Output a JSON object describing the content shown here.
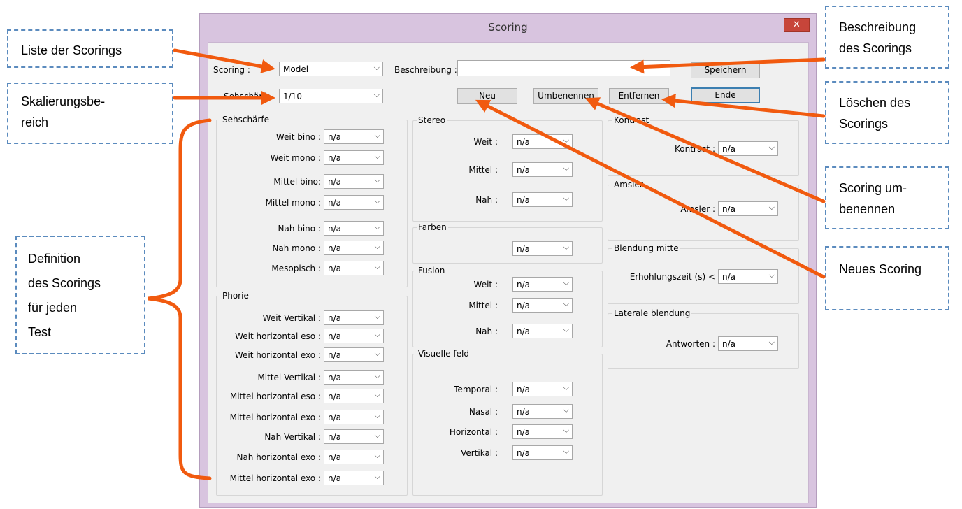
{
  "window": {
    "title": "Scoring",
    "close_glyph": "✕"
  },
  "top": {
    "scoring_label": "Scoring :",
    "scoring_value": "Model",
    "scaling_label": "Sehschärfe",
    "scaling_value": "1/10",
    "description_label": "Beschreibung :",
    "description_value": "",
    "save_label": "Speichern",
    "end_label": "Ende",
    "new_label": "Neu",
    "rename_label": "Umbenennen",
    "remove_label": "Entfernen"
  },
  "groups": {
    "sehschaerfe": {
      "title": "Sehschärfe",
      "rows": [
        {
          "label": "Weit bino :",
          "value": "n/a"
        },
        {
          "label": "Weit mono :",
          "value": "n/a"
        },
        {
          "label": "Mittel bino:",
          "value": "n/a"
        },
        {
          "label": "Mittel mono :",
          "value": "n/a"
        },
        {
          "label": "Nah bino :",
          "value": "n/a"
        },
        {
          "label": "Nah mono :",
          "value": "n/a"
        },
        {
          "label": "Mesopisch :",
          "value": "n/a"
        }
      ]
    },
    "phorie": {
      "title": "Phorie",
      "rows": [
        {
          "label": "Weit Vertikal :",
          "value": "n/a"
        },
        {
          "label": "Weit horizontal eso :",
          "value": "n/a"
        },
        {
          "label": "Weit horizontal exo :",
          "value": "n/a"
        },
        {
          "label": "Mittel Vertikal :",
          "value": "n/a"
        },
        {
          "label": "Mittel horizontal eso :",
          "value": "n/a"
        },
        {
          "label": "Mittel horizontal exo :",
          "value": "n/a"
        },
        {
          "label": "Nah Vertikal :",
          "value": "n/a"
        },
        {
          "label": "Nah horizontal exo :",
          "value": "n/a"
        },
        {
          "label": "Mittel horizontal exo :",
          "value": "n/a"
        }
      ]
    },
    "stereo": {
      "title": "Stereo",
      "rows": [
        {
          "label": "Weit :",
          "value": "n/a"
        },
        {
          "label": "Mittel :",
          "value": "n/a"
        },
        {
          "label": "Nah :",
          "value": "n/a"
        }
      ]
    },
    "farben": {
      "title": "Farben",
      "rows": [
        {
          "label": "",
          "value": "n/a"
        }
      ]
    },
    "fusion": {
      "title": "Fusion",
      "rows": [
        {
          "label": "Weit :",
          "value": "n/a"
        },
        {
          "label": "Mittel :",
          "value": "n/a"
        },
        {
          "label": "Nah :",
          "value": "n/a"
        }
      ]
    },
    "visuelle": {
      "title": "Visuelle feld",
      "rows": [
        {
          "label": "Temporal :",
          "value": "n/a"
        },
        {
          "label": "Nasal :",
          "value": "n/a"
        },
        {
          "label": "Horizontal :",
          "value": "n/a"
        },
        {
          "label": "Vertikal :",
          "value": "n/a"
        }
      ]
    },
    "kontrast": {
      "title": "Kontrast",
      "rows": [
        {
          "label": "Kontrast :",
          "value": "n/a"
        }
      ]
    },
    "amsler": {
      "title": "Amsler",
      "rows": [
        {
          "label": "Amsler :",
          "value": "n/a"
        }
      ]
    },
    "blendung": {
      "title": "Blendung mitte",
      "rows": [
        {
          "label": "Erhohlungszeit (s) <",
          "value": "n/a"
        }
      ]
    },
    "laterale": {
      "title": "Laterale blendung",
      "rows": [
        {
          "label": "Antworten :",
          "value": "n/a"
        }
      ]
    }
  },
  "callouts": {
    "liste": "Liste der Scorings",
    "skala_1": "Skalierungsbe-",
    "skala_2": "reich",
    "definition_1": "Definition",
    "definition_2": "des Scorings",
    "definition_3": "für jeden",
    "definition_4": "Test",
    "beschreibung_1": "Beschreibung",
    "beschreibung_2": "des Scorings",
    "loeschen_1": "Löschen des",
    "loeschen_2": "Scorings",
    "umbenennen_1": "Scoring um-",
    "umbenennen_2": "benennen",
    "neues": "Neues Scoring"
  },
  "colors": {
    "arrow": "#f15a0f",
    "callout_border": "#5b8bbe",
    "close_button": "#c7453a",
    "window_frame": "#d8c4df"
  }
}
